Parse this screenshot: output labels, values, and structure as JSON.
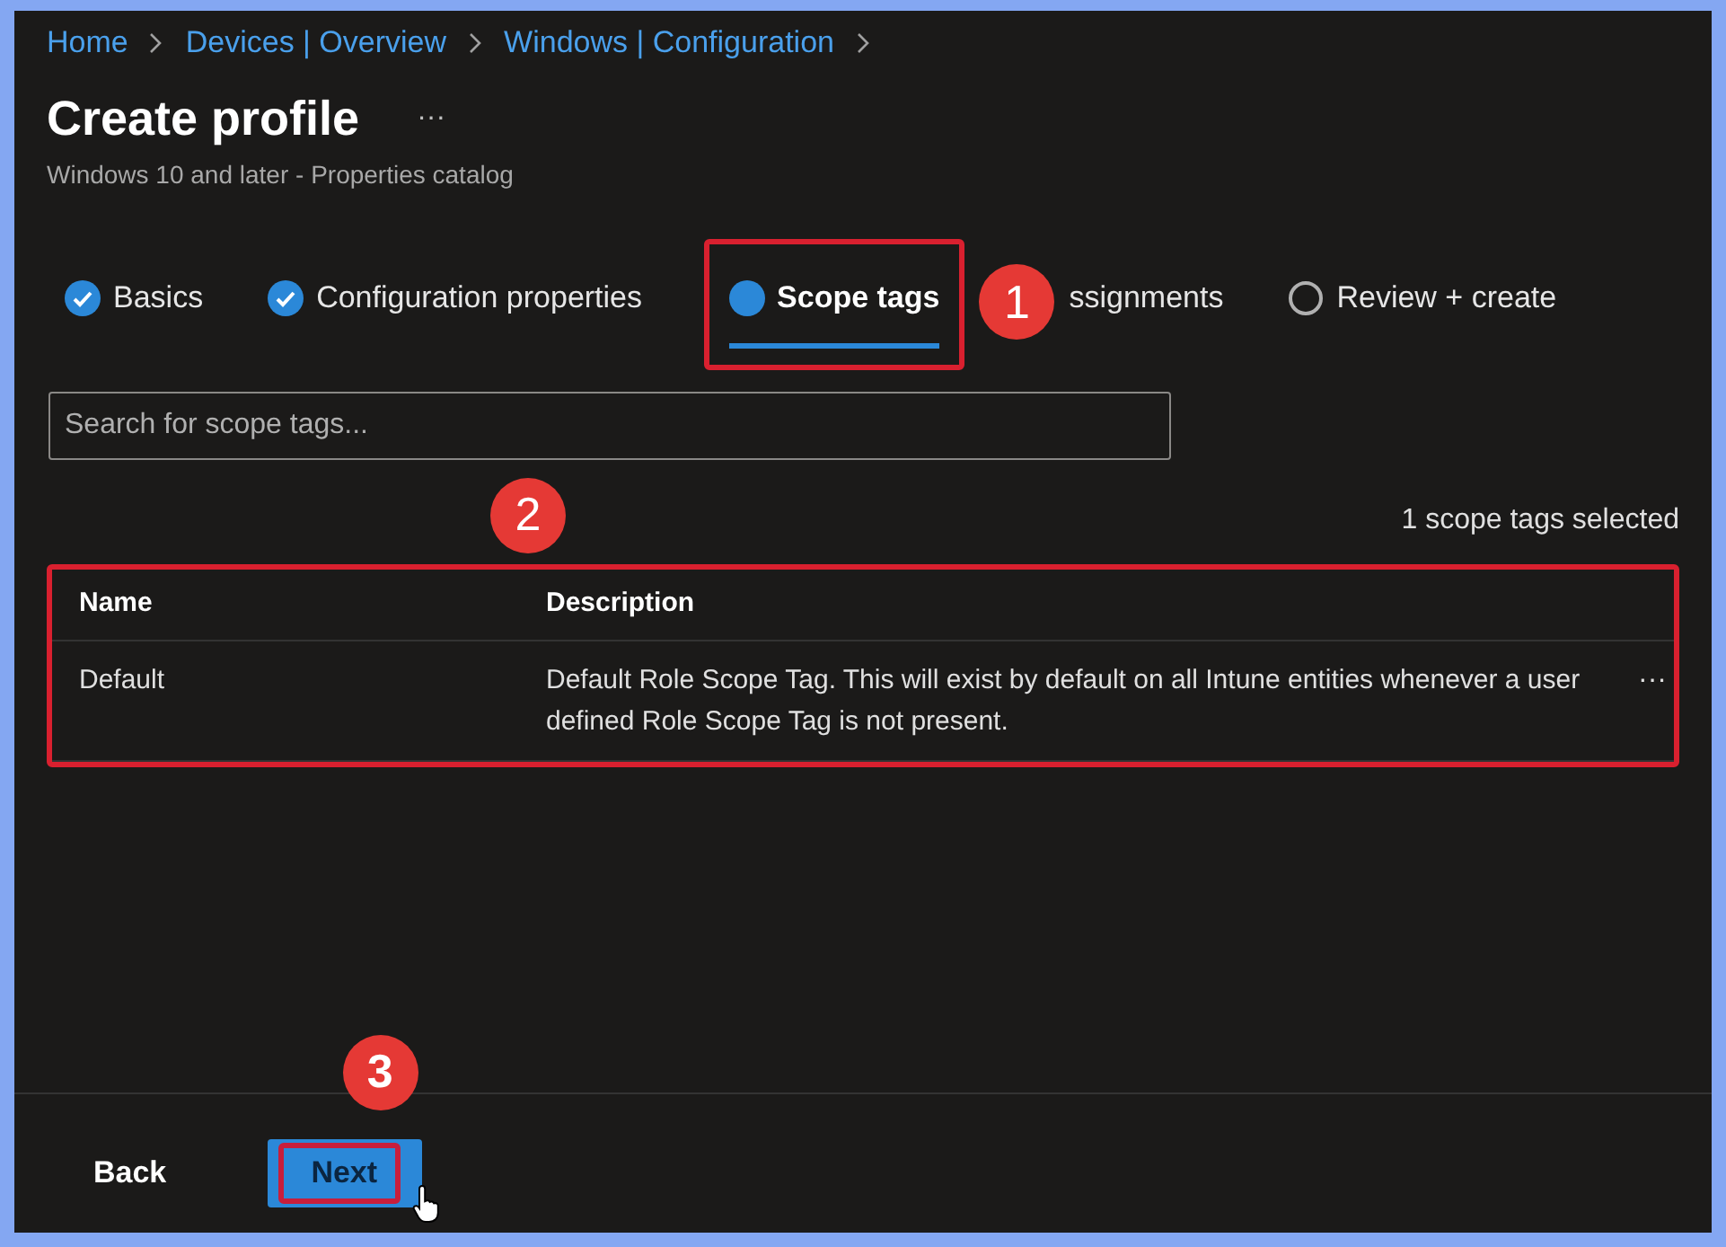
{
  "breadcrumb": [
    "Home",
    "Devices | Overview",
    "Windows | Configuration"
  ],
  "title": "Create profile",
  "more": "···",
  "subtitle": "Windows 10 and later - Properties catalog",
  "steps": [
    {
      "label": "Basics",
      "kind": "done",
      "selected": false
    },
    {
      "label": "Configuration properties",
      "kind": "done",
      "selected": false
    },
    {
      "label": "Scope tags",
      "kind": "current",
      "selected": true
    },
    {
      "label": "ssignments",
      "selected": false
    },
    {
      "label": "Review + create",
      "kind": "pending",
      "selected": false
    }
  ],
  "search": {
    "placeholder": "Search for scope tags..."
  },
  "selected_count": "1 scope tags selected",
  "table": {
    "columns": [
      "Name",
      "Description"
    ],
    "rows": [
      {
        "name": "Default",
        "description": "Default Role Scope Tag. This will exist by default on all Intune entities whenever a user defined Role Scope Tag is not present.",
        "menu": "···"
      }
    ]
  },
  "callouts": [
    "1",
    "2",
    "3"
  ],
  "buttons": [
    {
      "label": "Back",
      "kind": "secondary"
    },
    {
      "label": "Next",
      "kind": "primary"
    }
  ]
}
